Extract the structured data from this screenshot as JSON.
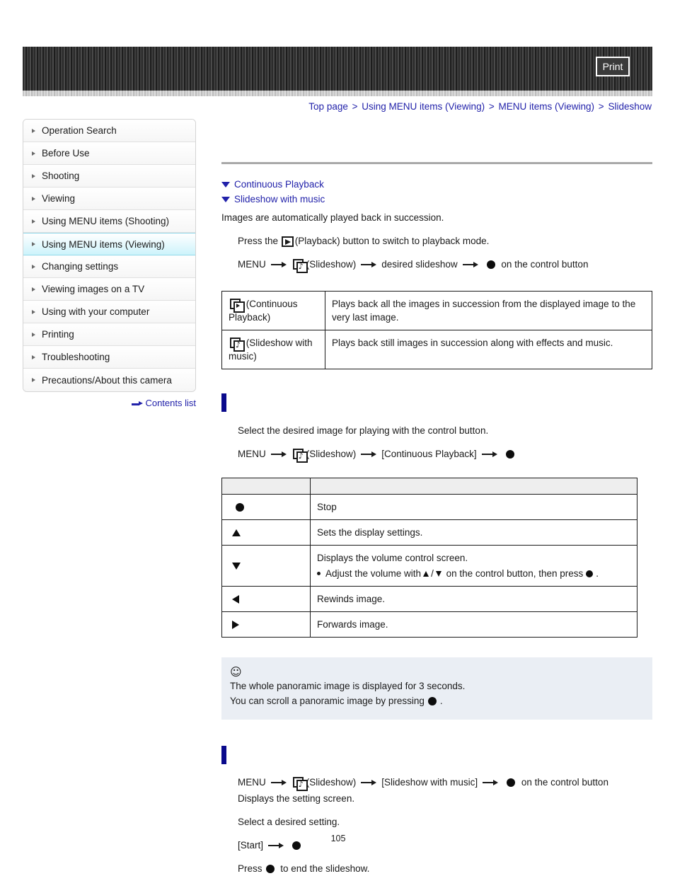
{
  "header": {
    "print_label": "Print"
  },
  "breadcrumb": {
    "separator": ">",
    "items": [
      {
        "label": "Top page"
      },
      {
        "label": "Using MENU items (Viewing)"
      },
      {
        "label": "MENU items (Viewing)"
      },
      {
        "label": "Slideshow"
      }
    ]
  },
  "sidebar": {
    "items": [
      {
        "label": "Operation Search",
        "active": false
      },
      {
        "label": "Before Use",
        "active": false
      },
      {
        "label": "Shooting",
        "active": false
      },
      {
        "label": "Viewing",
        "active": false
      },
      {
        "label": "Using MENU items (Shooting)",
        "active": false
      },
      {
        "label": "Using MENU items (Viewing)",
        "active": true
      },
      {
        "label": "Changing settings",
        "active": false
      },
      {
        "label": "Viewing images on a TV",
        "active": false
      },
      {
        "label": "Using with your computer",
        "active": false
      },
      {
        "label": "Printing",
        "active": false
      },
      {
        "label": "Troubleshooting",
        "active": false
      },
      {
        "label": "Precautions/About this camera",
        "active": false
      }
    ],
    "contents_list_label": "Contents list"
  },
  "main": {
    "anchors": [
      {
        "label": "Continuous Playback"
      },
      {
        "label": "Slideshow with music"
      }
    ],
    "intro": "Images are automatically played back in succession.",
    "step_playback": {
      "prefix": "Press the",
      "icon_label": "(Playback) button to switch to playback mode."
    },
    "step_menu": {
      "menu": "MENU",
      "slideshow_label": "(Slideshow)",
      "target": "desired slideshow",
      "suffix": "on the control button"
    },
    "modes_table": {
      "rows": [
        {
          "mode": "(Continuous Playback)",
          "desc": "Plays back all the images in succession from the displayed image to the very last image."
        },
        {
          "mode": "(Slideshow with music)",
          "desc": "Plays back still images in succession along with effects and music."
        }
      ]
    },
    "continuous_section": {
      "intro": "Select the desired image for playing with the control button.",
      "step": {
        "menu": "MENU",
        "slideshow_label": "(Slideshow)",
        "target": "[Continuous Playback]"
      }
    },
    "controls_table": {
      "header": {
        "key_col": "",
        "desc_col": ""
      },
      "rows": [
        {
          "key_icon": "dot-icon",
          "desc": "Stop"
        },
        {
          "key_icon": "tri-up-icon",
          "desc": "Sets the display settings."
        },
        {
          "key_icon": "tri-down-icon",
          "desc": "Displays the volume control screen.",
          "bullet": {
            "prefix": "Adjust the volume with",
            "separator": "/",
            "middle": "on the control button, then press",
            "suffix": "."
          }
        },
        {
          "key_icon": "tri-left-icon",
          "desc": "Rewinds image."
        },
        {
          "key_icon": "tri-right-icon",
          "desc": "Forwards image."
        }
      ]
    },
    "tip_box": {
      "bulb": "¡",
      "line1": "The whole panoramic image is displayed for 3 seconds.",
      "line2_prefix": "You can scroll a panoramic image by pressing",
      "line2_suffix": "."
    },
    "withmusic_section": {
      "step": {
        "menu": "MENU",
        "slideshow_label": "(Slideshow)",
        "target": "[Slideshow with music]",
        "suffix": "on the control button"
      },
      "line_displays": "Displays the setting screen.",
      "line_select": "Select a desired setting.",
      "line_start": "[Start]",
      "line_press_prefix": "Press",
      "line_press_suffix": "to end the slideshow."
    },
    "page_number": "105"
  }
}
